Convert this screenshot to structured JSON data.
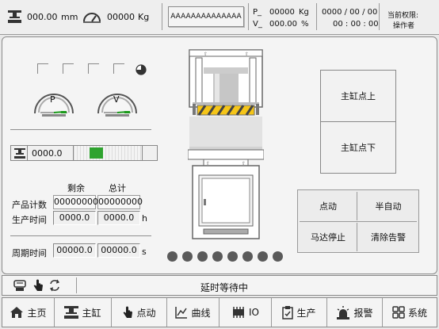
{
  "header": {
    "displacement": {
      "value": "000.00",
      "unit": "mm",
      "icon": "press-icon"
    },
    "load": {
      "value": "00000",
      "unit": "Kg",
      "icon": "meter-icon"
    },
    "title": "AAAAAAAAAAAAAA",
    "pressure": {
      "label": "P_",
      "value": "00000",
      "unit": "Kg"
    },
    "velocity": {
      "label": "V_",
      "value": "000.00",
      "unit": "%"
    },
    "date": "0000 / 00 / 00",
    "time": "00 : 00 : 00",
    "permission_label": "当前权限:",
    "permission_value": "操作者"
  },
  "gauges": {
    "p_label": "P",
    "v_label": "V"
  },
  "position_readout": {
    "value": "0000.0",
    "progress": 0.25
  },
  "counters": {
    "col_remaining": "剩余",
    "col_total": "总计",
    "product_count_label": "产品计数",
    "product_remaining": "00000000",
    "product_total": "00000000",
    "production_time_label": "生产时间",
    "production_remaining": "0000.0",
    "production_total": "0000.0",
    "production_unit": "h",
    "cycle_time_label": "周期时间",
    "cycle_value1": "00000.0",
    "cycle_value2": "00000.0",
    "cycle_unit": "s"
  },
  "cylinder_buttons": {
    "up": "主缸点上",
    "down": "主缸点下"
  },
  "mode_buttons": {
    "jog": "点动",
    "semi_auto": "半自动",
    "motor_stop": "马达停止",
    "clear_alarm": "清除告警"
  },
  "status": {
    "message": "延时等待中"
  },
  "nav": {
    "items": [
      {
        "label": "主页",
        "icon": "home-icon"
      },
      {
        "label": "主缸",
        "icon": "cylinder-icon"
      },
      {
        "label": "点动",
        "icon": "hand-icon"
      },
      {
        "label": "曲线",
        "icon": "curve-icon"
      },
      {
        "label": "IO",
        "icon": "io-icon"
      },
      {
        "label": "生产",
        "icon": "clipboard-icon"
      },
      {
        "label": "报警",
        "icon": "alarm-icon"
      },
      {
        "label": "系统",
        "icon": "system-icon"
      }
    ]
  }
}
